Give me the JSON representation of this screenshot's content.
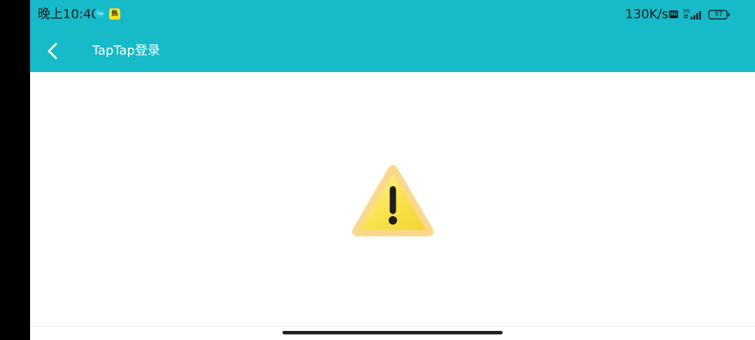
{
  "status_bar": {
    "time": "晚上10:40",
    "notification_tap_label": "Tap",
    "notification_hot_label": "热",
    "network_speed": "130K/s",
    "hd_label": "HD",
    "network_type": "5G",
    "battery_level": "97"
  },
  "app_bar": {
    "title": "TapTap登录",
    "background_color": "#16bac8",
    "back_icon": "chevron-left-icon"
  },
  "content": {
    "status_icon": "warning-icon",
    "warning_color": "#f9e24a"
  }
}
